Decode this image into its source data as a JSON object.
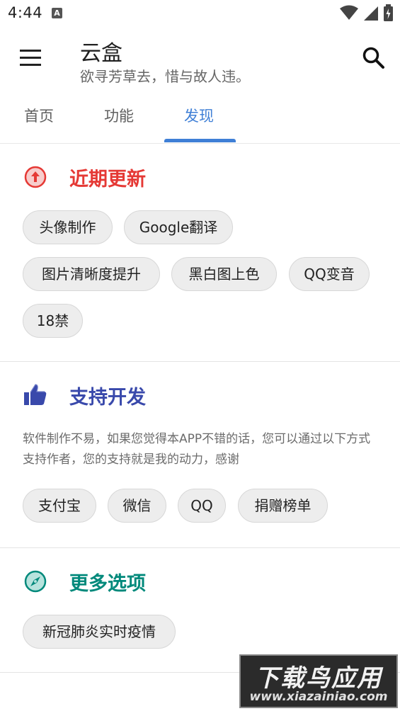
{
  "status_bar": {
    "time": "4:44",
    "notification_badge": "A"
  },
  "app_bar": {
    "title": "云盒",
    "subtitle": "欲寻芳草去，惜与故人违。",
    "menu_icon": "menu-icon",
    "search_icon": "search-icon"
  },
  "tabs": [
    {
      "label": "首页",
      "active": false
    },
    {
      "label": "功能",
      "active": false
    },
    {
      "label": "发现",
      "active": true
    }
  ],
  "sections": {
    "recent": {
      "title": "近期更新",
      "icon": "arrow-up-circle-icon",
      "color": "#e53935",
      "chips": [
        "头像制作",
        "Google翻译",
        "图片清晰度提升",
        "黑白图上色",
        "QQ变音",
        "18禁"
      ]
    },
    "support": {
      "title": "支持开发",
      "icon": "thumb-up-icon",
      "color": "#3949ab",
      "description": "软件制作不易，如果您觉得本APP不错的话，您可以通过以下方式支持作者，您的支持就是我的动力，感谢",
      "chips": [
        "支付宝",
        "微信",
        "QQ",
        "捐赠榜单"
      ]
    },
    "more": {
      "title": "更多选项",
      "icon": "compass-icon",
      "color": "#00897b",
      "chips": [
        "新冠肺炎实时疫情"
      ]
    }
  },
  "watermark": {
    "main": "下载鸟应用",
    "url": "www.xiazainiao.com"
  },
  "colors": {
    "accent": "#3f7fd6",
    "chip_bg": "#ededed"
  }
}
